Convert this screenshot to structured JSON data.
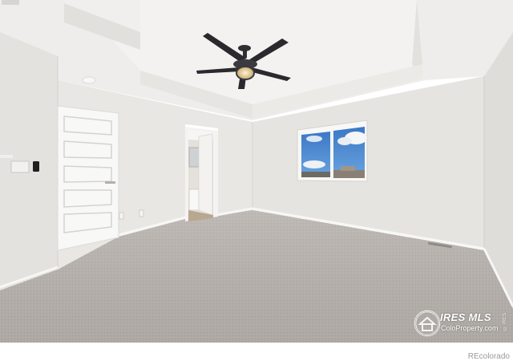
{
  "photo": {
    "subject": "Empty bedroom with carpet, ceiling fan and window",
    "colors": {
      "wall": "#e6e4e0",
      "ceiling": "#efeeec",
      "carpet": "#b7b2ad",
      "trim": "#f6f6f4",
      "fan": "#2f2f33",
      "sky": "#3e7fc9"
    }
  },
  "watermark": {
    "brand": "IRES MLS",
    "subtitle": "ColoProperty.com",
    "vertical_text": "© IRES"
  },
  "footer": {
    "credit": "REcolorado"
  }
}
